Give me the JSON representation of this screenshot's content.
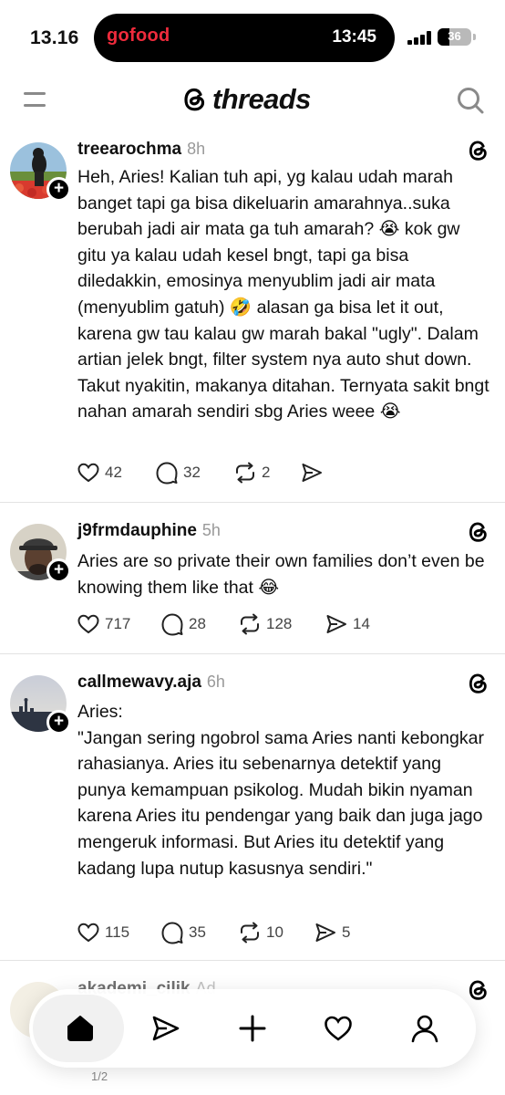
{
  "status_bar": {
    "time": "13.16",
    "island_app": "gofood",
    "island_time": "13:45",
    "battery": "36"
  },
  "header": {
    "brand": "threads"
  },
  "posts": [
    {
      "username": "treearochma",
      "time": "8h",
      "text": "Heh, Aries! Kalian tuh api, yg kalau udah marah banget tapi ga bisa dikeluarin amarahnya..suka berubah jadi air mata ga tuh amarah? 😭 kok gw gitu ya kalau udah kesel bngt, tapi ga bisa diledakkin, emosinya menyublim jadi air mata (menyublim gatuh) 🤣 alasan ga bisa let it out, karena gw tau kalau gw marah bakal \"ugly\". Dalam artian jelek bngt, filter system nya auto shut down. Takut nyakitin, makanya ditahan. Ternyata sakit bngt nahan amarah sendiri sbg Aries weee 😭",
      "likes": "42",
      "replies": "32",
      "reposts": "2",
      "shares": ""
    },
    {
      "username": "j9frmdauphine",
      "time": "5h",
      "text": "Aries are so private their own families don’t even be knowing them like that 😂",
      "likes": "717",
      "replies": "28",
      "reposts": "128",
      "shares": "14"
    },
    {
      "username": "callmewavy.aja",
      "time": "6h",
      "text": "Aries:\n\"Jangan sering ngobrol sama Aries nanti kebongkar rahasianya. Aries itu sebenarnya detektif yang punya kemampuan psikolog. Mudah bikin nyaman karena Aries itu pendengar yang baik dan juga jago mengeruk informasi. But Aries itu detektif yang kadang lupa nutup kasusnya sendiri.\"",
      "likes": "115",
      "replies": "35",
      "reposts": "10",
      "shares": "5"
    }
  ],
  "peek_post": {
    "username": "akademi_cilik",
    "time": "Ad",
    "page": "1/2"
  },
  "nav": {
    "items": [
      "home-icon",
      "send-icon",
      "plus-icon",
      "heart-icon",
      "profile-icon"
    ]
  },
  "colors": {
    "island_app": "#ef2b3c",
    "muted": "#999999",
    "text": "#101010"
  }
}
